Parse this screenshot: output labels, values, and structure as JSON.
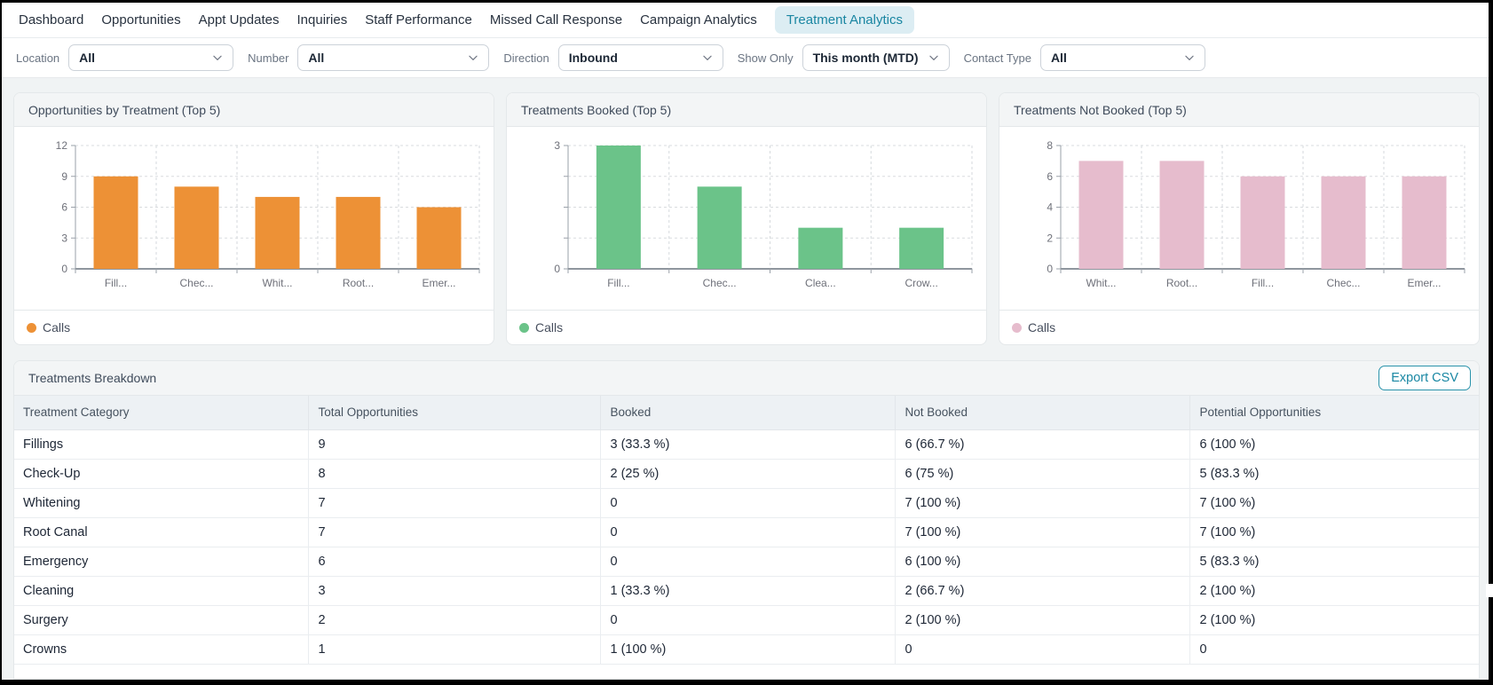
{
  "nav": {
    "tabs": [
      {
        "label": "Dashboard",
        "active": false
      },
      {
        "label": "Opportunities",
        "active": false
      },
      {
        "label": "Appt Updates",
        "active": false
      },
      {
        "label": "Inquiries",
        "active": false
      },
      {
        "label": "Staff Performance",
        "active": false
      },
      {
        "label": "Missed Call Response",
        "active": false
      },
      {
        "label": "Campaign Analytics",
        "active": false
      },
      {
        "label": "Treatment Analytics",
        "active": true
      }
    ]
  },
  "filters": [
    {
      "label": "Location",
      "value": "All"
    },
    {
      "label": "Number",
      "value": "All"
    },
    {
      "label": "Direction",
      "value": "Inbound"
    },
    {
      "label": "Show Only",
      "value": "This month (MTD)"
    },
    {
      "label": "Contact Type",
      "value": "All"
    }
  ],
  "colors": {
    "accent_teal": "#1987a3",
    "active_tab_bg": "#dcedf3",
    "orange": "#ED9136",
    "green": "#6BC389",
    "pink": "#E6BCCD"
  },
  "chart_data": [
    {
      "type": "bar",
      "title": "Opportunities by Treatment (Top 5)",
      "categories": [
        "Fill...",
        "Chec...",
        "Whit...",
        "Root...",
        "Emer..."
      ],
      "values": [
        9,
        8,
        7,
        7,
        6
      ],
      "series_name": "Calls",
      "legend": "Calls",
      "color": "#ED9136",
      "ylim": [
        0,
        12
      ],
      "y_ticks": [
        {
          "v": 0,
          "label": "0"
        },
        {
          "v": 3,
          "label": "3"
        },
        {
          "v": 6,
          "label": "6"
        },
        {
          "v": 9,
          "label": "9"
        },
        {
          "v": 12,
          "label": "12"
        }
      ]
    },
    {
      "type": "bar",
      "title": "Treatments Booked (Top 5)",
      "categories": [
        "Fill...",
        "Chec...",
        "Clea...",
        "Crow..."
      ],
      "values": [
        3,
        2,
        1,
        1
      ],
      "series_name": "Calls",
      "legend": "Calls",
      "color": "#6BC389",
      "ylim": [
        0,
        3
      ],
      "y_ticks": [
        {
          "v": 0,
          "label": "0"
        },
        {
          "v": 0.75,
          "label": ""
        },
        {
          "v": 1.5,
          "label": ""
        },
        {
          "v": 2.25,
          "label": ""
        },
        {
          "v": 3,
          "label": "3"
        }
      ]
    },
    {
      "type": "bar",
      "title": "Treatments Not Booked (Top 5)",
      "categories": [
        "Whit...",
        "Root...",
        "Fill...",
        "Chec...",
        "Emer..."
      ],
      "values": [
        7,
        7,
        6,
        6,
        6
      ],
      "series_name": "Calls",
      "legend": "Calls",
      "color": "#E6BCCD",
      "ylim": [
        0,
        8
      ],
      "y_ticks": [
        {
          "v": 0,
          "label": "0"
        },
        {
          "v": 2,
          "label": "2"
        },
        {
          "v": 4,
          "label": "4"
        },
        {
          "v": 6,
          "label": "6"
        },
        {
          "v": 8,
          "label": "8"
        }
      ]
    }
  ],
  "breakdown": {
    "title": "Treatments Breakdown",
    "export_label": "Export CSV",
    "columns": [
      "Treatment Category",
      "Total Opportunities",
      "Booked",
      "Not Booked",
      "Potential Opportunities"
    ],
    "rows": [
      [
        "Fillings",
        "9",
        "3 (33.3 %)",
        "6 (66.7 %)",
        "6 (100 %)"
      ],
      [
        "Check-Up",
        "8",
        "2 (25 %)",
        "6 (75 %)",
        "5 (83.3 %)"
      ],
      [
        "Whitening",
        "7",
        "0",
        "7 (100 %)",
        "7 (100 %)"
      ],
      [
        "Root Canal",
        "7",
        "0",
        "7 (100 %)",
        "7 (100 %)"
      ],
      [
        "Emergency",
        "6",
        "0",
        "6 (100 %)",
        "5 (83.3 %)"
      ],
      [
        "Cleaning",
        "3",
        "1 (33.3 %)",
        "2 (66.7 %)",
        "2 (100 %)"
      ],
      [
        "Surgery",
        "2",
        "0",
        "2 (100 %)",
        "2 (100 %)"
      ],
      [
        "Crowns",
        "1",
        "1 (100 %)",
        "0",
        "0"
      ]
    ]
  }
}
